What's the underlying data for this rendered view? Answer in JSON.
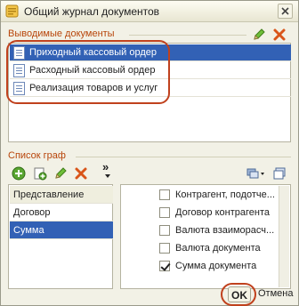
{
  "window": {
    "title": "Общий журнал документов"
  },
  "output_documents": {
    "title": "Выводимые документы",
    "items": [
      {
        "label": "Приходный кассовый ордер",
        "selected": true
      },
      {
        "label": "Расходный кассовый ордер",
        "selected": false
      },
      {
        "label": "Реализация товаров и услуг",
        "selected": false
      }
    ]
  },
  "columns": {
    "title": "Список граф",
    "more_label": "»",
    "left_list": {
      "header": "Представление",
      "items": [
        {
          "label": "Договор",
          "selected": false
        },
        {
          "label": "Сумма",
          "selected": true
        }
      ]
    },
    "right_list": [
      {
        "label": "Контрагент, подотче...",
        "checked": false
      },
      {
        "label": "Договор контрагента",
        "checked": false
      },
      {
        "label": "Валюта взаиморасч...",
        "checked": false
      },
      {
        "label": "Валюта документа",
        "checked": false
      },
      {
        "label": "Сумма документа",
        "checked": true
      }
    ]
  },
  "buttons": {
    "ok": "OK",
    "cancel": "Отмена"
  },
  "colors": {
    "accent": "#b8450a",
    "selection": "#3261b5",
    "highlight": "#c0411d"
  }
}
